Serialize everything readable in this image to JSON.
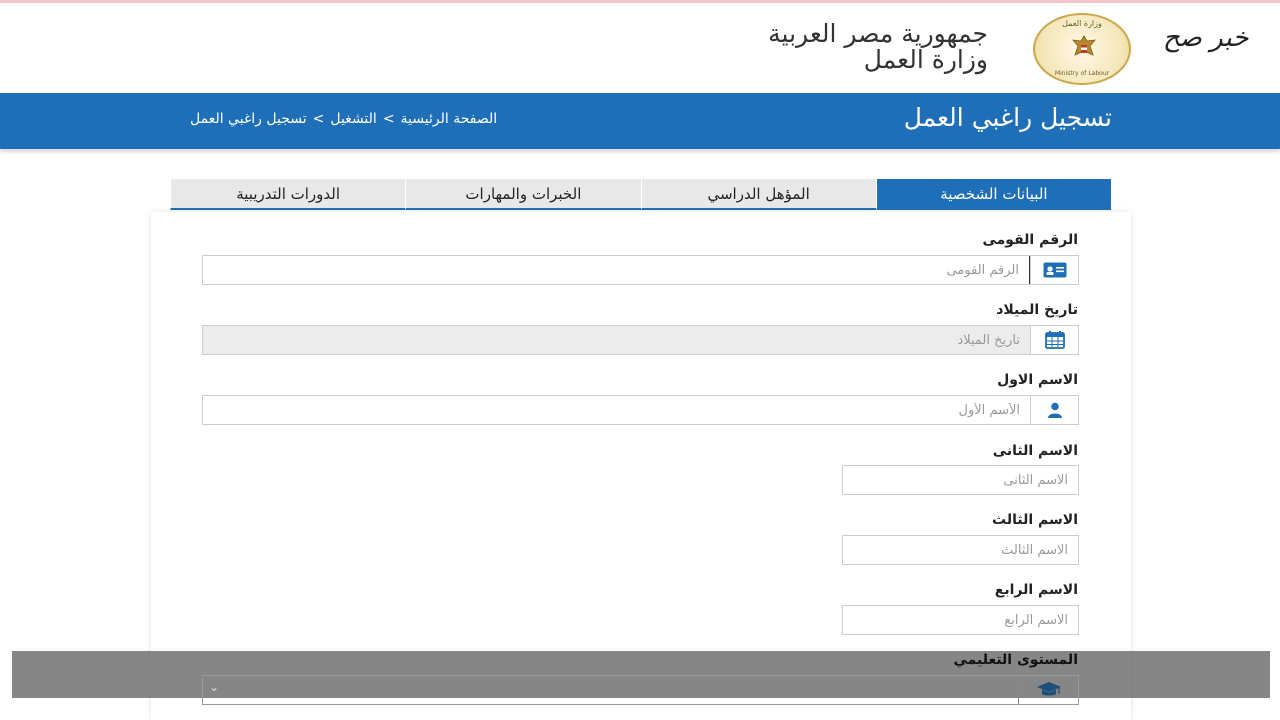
{
  "watermark": "خبر صح",
  "header": {
    "gov_line1": "جمهورية مصر العربية",
    "gov_line2": "وزارة العمل",
    "emblem_top": "وزارة العمل",
    "emblem_bottom": "Ministry of Labour"
  },
  "banner": {
    "title": "تسجيل راغبي العمل",
    "breadcrumb": {
      "home": "الصفحة الرئيسية",
      "sep1": ">",
      "employment": "التشغيل",
      "sep2": ">",
      "current": "تسجيل راغبي العمل"
    }
  },
  "tabs": [
    {
      "label": "البيانات الشخصية",
      "active": true
    },
    {
      "label": "المؤهل الدراسي",
      "active": false
    },
    {
      "label": "الخبرات والمهارات",
      "active": false
    },
    {
      "label": "الدورات التدريبية",
      "active": false
    }
  ],
  "form": {
    "national_id": {
      "label": "الرقم القومى",
      "placeholder": "الرقم القومى",
      "icon": "id-card-icon"
    },
    "birth_date": {
      "label": "تاريخ الميلاد",
      "placeholder": "تاريخ الميلاد",
      "icon": "calendar-icon"
    },
    "first_name": {
      "label": "الاسم الاول",
      "placeholder": "الأسم الأول",
      "icon": "user-icon"
    },
    "second_name": {
      "label": "الاسم الثانى",
      "placeholder": "الاسم الثانى"
    },
    "third_name": {
      "label": "الاسم الثالث",
      "placeholder": "الاسم الثالث"
    },
    "fourth_name": {
      "label": "الاسم الرابع",
      "placeholder": "الاسم الرابع"
    },
    "education_level": {
      "label": "المستوى التعليمي",
      "icon": "graduation-cap-icon"
    }
  },
  "colors": {
    "brand_blue": "#1e6fb8",
    "tab_inactive": "#e8e8e8"
  }
}
